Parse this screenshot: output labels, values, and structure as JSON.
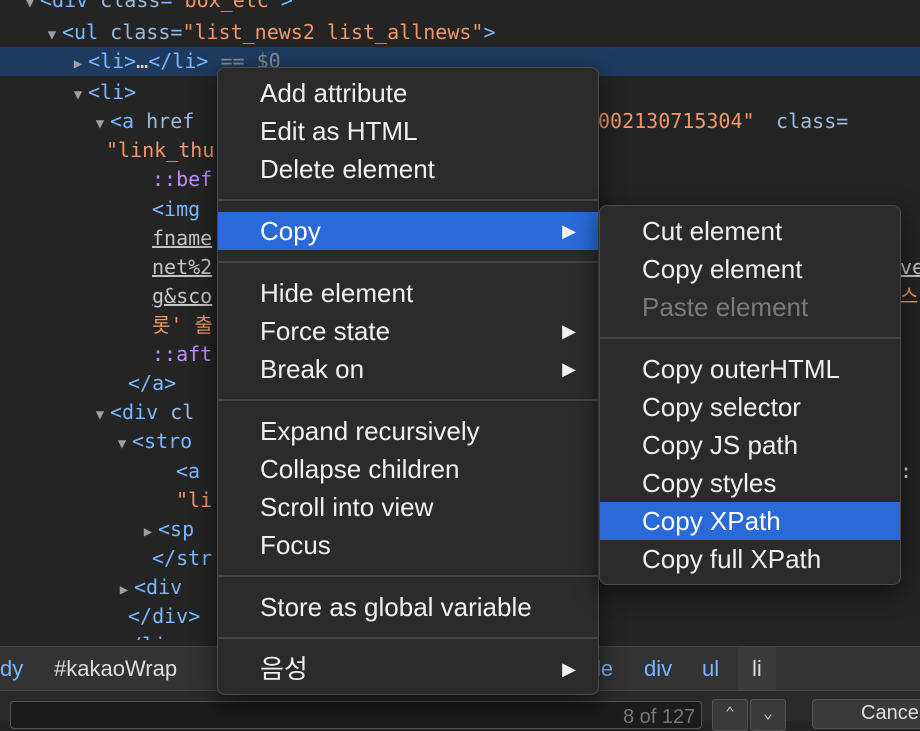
{
  "code_lines": [
    {
      "tri": "▼",
      "parts": [
        [
          "tag",
          "<div "
        ],
        [
          "attr",
          "class"
        ],
        [
          "tag",
          "="
        ],
        [
          "val",
          "\"box_etc\""
        ],
        [
          "tag",
          ">"
        ]
      ]
    },
    {
      "tri": "▼",
      "parts": [
        [
          "tag",
          "<ul "
        ],
        [
          "attr",
          "class"
        ],
        [
          "tag",
          "="
        ],
        [
          "val",
          "\"list_news2 list_allnews\""
        ],
        [
          "tag",
          ">"
        ]
      ]
    },
    {
      "tri": "▶",
      "parts": [
        [
          "tag",
          "<li>"
        ],
        [
          "txt",
          "…"
        ],
        [
          "tag",
          "</li>"
        ],
        [
          "dim",
          " == $0"
        ]
      ]
    },
    {
      "tri": "▼",
      "parts": [
        [
          "tag",
          "<li>"
        ]
      ]
    },
    {
      "tri": "▼",
      "parts": [
        [
          "tag",
          "<a "
        ],
        [
          "attr",
          "href"
        ]
      ]
    },
    {
      "tri": "",
      "parts": [
        [
          "val",
          "\"link_thu"
        ]
      ]
    },
    {
      "tri": "",
      "parts": [
        [
          "pseudo",
          "::bef"
        ]
      ]
    },
    {
      "tri": "",
      "parts": [
        [
          "tag",
          "<img "
        ]
      ]
    },
    {
      "tri": "",
      "parts": [
        [
          "ul",
          "fname"
        ]
      ]
    },
    {
      "tri": "",
      "parts": [
        [
          "ul",
          "net%2"
        ]
      ]
    },
    {
      "tri": "",
      "parts": [
        [
          "ul",
          "g&sco"
        ]
      ]
    },
    {
      "tri": "",
      "parts": [
        [
          "ko",
          "롯' 출"
        ]
      ]
    },
    {
      "tri": "",
      "parts": [
        [
          "pseudo",
          "::aft"
        ]
      ]
    },
    {
      "tri": "",
      "parts": [
        [
          "tag",
          "</a>"
        ]
      ]
    },
    {
      "tri": "▼",
      "parts": [
        [
          "tag",
          "<div "
        ],
        [
          "attr",
          "cl"
        ]
      ]
    },
    {
      "tri": "▼",
      "parts": [
        [
          "tag",
          "<stro"
        ]
      ]
    },
    {
      "tri": "",
      "parts": [
        [
          "tag",
          "<a "
        ]
      ]
    },
    {
      "tri": "",
      "parts": [
        [
          "val",
          "\"li"
        ]
      ]
    },
    {
      "tri": "▶",
      "parts": [
        [
          "tag",
          "<sp"
        ]
      ]
    },
    {
      "tri": "",
      "parts": [
        [
          "tag",
          "</str"
        ]
      ]
    },
    {
      "tri": "▶",
      "parts": [
        [
          "tag",
          "<div "
        ]
      ]
    },
    {
      "tri": "",
      "parts": [
        [
          "tag",
          "</div>"
        ]
      ]
    },
    {
      "tri": "",
      "parts": [
        [
          "tag",
          "</li>"
        ]
      ]
    }
  ],
  "code_right": {
    "href_tail": "002130715304\"",
    "class_tail": " class=",
    "ve": "ve",
    "ko_tail": "스",
    "colon": ":"
  },
  "breadcrumbs": [
    "dy",
    "#kakaoWrap",
    "le",
    "div",
    "ul",
    "li"
  ],
  "search": {
    "count": "8 of 127",
    "up": "⌃",
    "down": "⌄",
    "cancel": "Cance"
  },
  "context_menu": {
    "groups": [
      [
        {
          "label": "Add attribute"
        },
        {
          "label": "Edit as HTML"
        },
        {
          "label": "Delete element"
        }
      ],
      [
        {
          "label": "Copy",
          "submenu": true,
          "highlighted": true
        }
      ],
      [
        {
          "label": "Hide element"
        },
        {
          "label": "Force state",
          "submenu": true
        },
        {
          "label": "Break on",
          "submenu": true
        }
      ],
      [
        {
          "label": "Expand recursively"
        },
        {
          "label": "Collapse children"
        },
        {
          "label": "Scroll into view"
        },
        {
          "label": "Focus"
        }
      ],
      [
        {
          "label": "Store as global variable"
        }
      ],
      [
        {
          "label": "음성",
          "submenu": true
        }
      ]
    ]
  },
  "copy_submenu": {
    "groups": [
      [
        {
          "label": "Cut element"
        },
        {
          "label": "Copy element"
        },
        {
          "label": "Paste element",
          "disabled": true
        }
      ],
      [
        {
          "label": "Copy outerHTML"
        },
        {
          "label": "Copy selector"
        },
        {
          "label": "Copy JS path"
        },
        {
          "label": "Copy styles"
        },
        {
          "label": "Copy XPath",
          "highlighted": true
        },
        {
          "label": "Copy full XPath"
        }
      ]
    ]
  },
  "colors": {
    "highlight": "#2a6ad8",
    "menu_bg": "#2b2b2c",
    "panel_bg": "#242424",
    "tag": "#79b8ff",
    "attr_value": "#f29766"
  },
  "icons": {
    "submenu_arrow": "▶"
  }
}
